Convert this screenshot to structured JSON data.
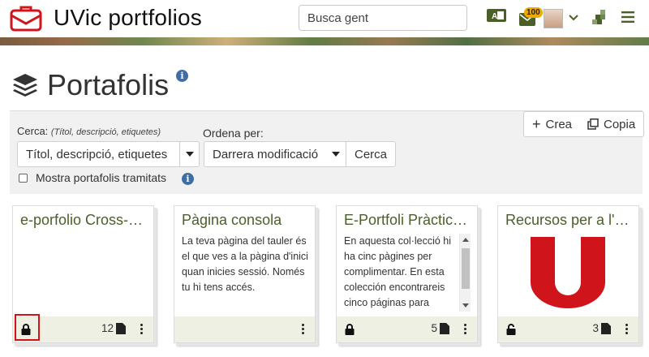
{
  "header": {
    "app_title": "UVic portfolios",
    "search_placeholder": "Busca gent",
    "notification_count": "100",
    "colors": {
      "brand_red": "#d0141c",
      "card_title": "#4a6028",
      "info_blue": "#3f6ea5",
      "badge": "#f2a900"
    }
  },
  "page": {
    "title": "Portafolis"
  },
  "toolbar": {
    "create_label": "Crea",
    "copy_label": "Copia"
  },
  "filter": {
    "search_label": "Cerca:",
    "search_hint": "(Títol, descripció, etiquetes)",
    "search_select_value": "Títol, descripció, etiquetes",
    "order_label": "Ordena per:",
    "order_select_value": "Darrera modificació",
    "search_button": "Cerca",
    "show_submitted_label": "Mostra portafolis tramitats"
  },
  "cards": [
    {
      "title": "e-porfolio Cross-C...",
      "description": "",
      "count": "12",
      "lock_icon": "lock-icon"
    },
    {
      "title": "Pàgina consola",
      "description": "La teva pàgina del tauler és el que ves a la pàgina d'inici quan inicies sessió. Només tu hi tens accés.",
      "count": "",
      "lock_icon": ""
    },
    {
      "title": "E-Portfoli Pràcticu...",
      "description": "En aquesta col·lecció hi ha cinc pàgines per complimentar. En esta colección encontrareis cinco páginas para cumplimen",
      "count": "5",
      "lock_icon": "lock-icon"
    },
    {
      "title": "Recursos per a l'ú...",
      "description": "",
      "count": "3",
      "lock_icon": "unlock-icon"
    }
  ]
}
